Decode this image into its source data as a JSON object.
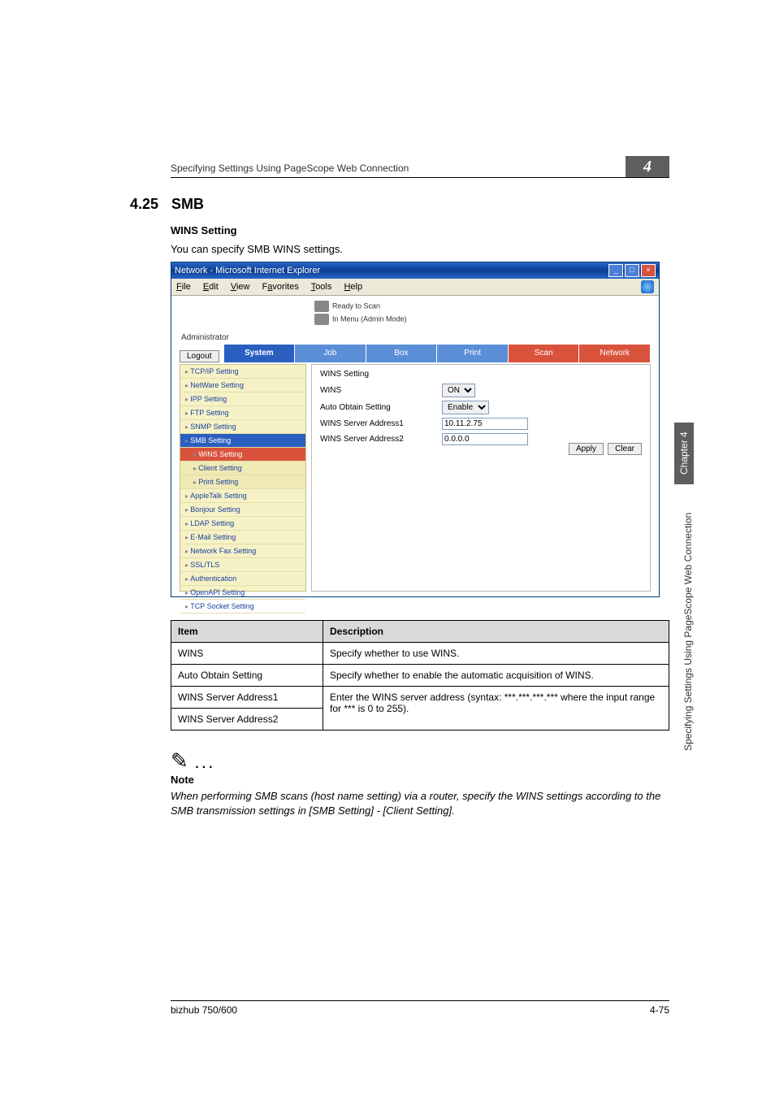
{
  "running_head": "Specifying Settings Using PageScope Web Connection",
  "chapter_number": "4",
  "section_number": "4.25",
  "section_title": "SMB",
  "subheading": "WINS Setting",
  "intro": "You can specify SMB WINS settings.",
  "ie_window": {
    "title": "Network - Microsoft Internet Explorer",
    "menus": [
      "File",
      "Edit",
      "View",
      "Favorites",
      "Tools",
      "Help"
    ],
    "status1": "Ready to Scan",
    "status2": "In Menu (Admin Mode)",
    "admin_label": "Administrator",
    "logout": "Logout",
    "tabs": {
      "system": "System",
      "job": "Job",
      "box": "Box",
      "print": "Print",
      "scan": "Scan",
      "network": "Network"
    },
    "sidebar": [
      "TCP/IP Setting",
      "NetWare Setting",
      "IPP Setting",
      "FTP Setting",
      "SNMP Setting",
      "SMB Setting",
      "WINS Setting",
      "Client Setting",
      "Print Setting",
      "AppleTalk Setting",
      "Bonjour Setting",
      "LDAP Setting",
      "E-Mail Setting",
      "Network Fax Setting",
      "SSL/TLS",
      "Authentication",
      "OpenAPI Setting",
      "TCP Socket Setting"
    ],
    "panel": {
      "heading": "WINS Setting",
      "rows": {
        "wins_label": "WINS",
        "wins_value": "ON",
        "auto_label": "Auto Obtain Setting",
        "auto_value": "Enable",
        "addr1_label": "WINS Server Address1",
        "addr1_value": "10.11.2.75",
        "addr2_label": "WINS Server Address2",
        "addr2_value": "0.0.0.0"
      },
      "apply": "Apply",
      "clear": "Clear"
    }
  },
  "table": {
    "head_item": "Item",
    "head_desc": "Description",
    "r1_item": "WINS",
    "r1_desc": "Specify whether to use WINS.",
    "r2_item": "Auto Obtain Setting",
    "r2_desc": "Specify whether to enable the automatic acquisition of WINS.",
    "r3_item": "WINS Server Address1",
    "r34_desc": "Enter the WINS server address (syntax: ***.***.***.*** where the input range for *** is 0 to 255).",
    "r4_item": "WINS Server Address2"
  },
  "note": {
    "title": "Note",
    "body": "When performing SMB scans (host name setting) via a router, specify the WINS settings according to the SMB transmission settings in [SMB Setting] - [Client Setting]."
  },
  "side": {
    "chapter": "Chapter 4",
    "text": "Specifying Settings Using PageScope Web Connection"
  },
  "footer": {
    "left": "bizhub 750/600",
    "right": "4-75"
  }
}
